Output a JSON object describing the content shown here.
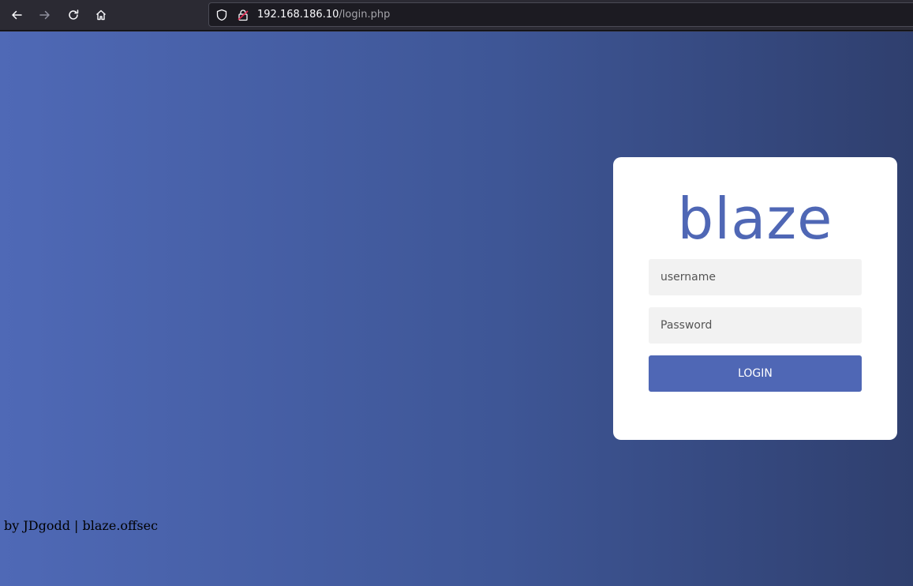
{
  "browser": {
    "url_host": "192.168.186.10",
    "url_path": "/login.php",
    "icons": [
      "back-arrow-icon",
      "forward-arrow-icon",
      "reload-icon",
      "home-icon",
      "shield-icon",
      "insecure-lock-icon"
    ]
  },
  "login": {
    "logo_text": "blaze",
    "username_placeholder": "username",
    "password_placeholder": "Password",
    "button_label": "LOGIN"
  },
  "footer": {
    "text": "by JDgodd | blaze.offsec"
  },
  "colors": {
    "brand": "#4f67b5",
    "background_gradient_start": "#4f69b6",
    "background_gradient_end": "#2f3f6e",
    "card": "#ffffff",
    "input_bg": "#f2f2f2"
  }
}
